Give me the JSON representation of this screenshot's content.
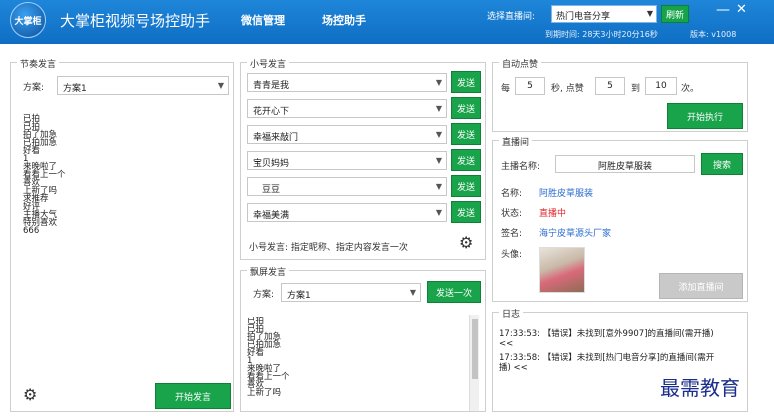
{
  "header": {
    "logo_text": "大掌柜",
    "app_title": "大掌柜视频号场控助手",
    "nav": [
      "微信管理",
      "场控助手"
    ],
    "live_label": "选择直播间:",
    "live_selected": "热门电音分享",
    "refresh_label": "刷新",
    "minimize": "—",
    "close": "✕",
    "expire_text": "到期时间: 28天3小时20分16秒",
    "version_text": "版本: v1008"
  },
  "rhythm": {
    "title": "节奏发言",
    "scheme_label": "方案:",
    "scheme_value": "方案1",
    "lines": [
      "已拍",
      "已拍",
      "拍了加急",
      "已拍加急",
      "好看",
      "1",
      "来晚啦了",
      "看看上一个",
      "喜欢",
      "上新了吗",
      "求推荐",
      "好评",
      "主播大气",
      "特别喜欢",
      "666"
    ],
    "start_label": "开始发言"
  },
  "accounts": {
    "title": "小号发言",
    "rows": [
      {
        "name": "青青是我",
        "send": "发送"
      },
      {
        "name": "花开心下",
        "send": "发送"
      },
      {
        "name": "幸福来敲门",
        "send": "发送"
      },
      {
        "name": "宝贝妈妈",
        "send": "发送"
      },
      {
        "name": "豆豆",
        "send": "发送"
      },
      {
        "name": "幸福美满",
        "send": "发送"
      }
    ],
    "hint": "小号发言: 指定昵称、指定内容发言一次"
  },
  "danmaku": {
    "title": "飘屏发言",
    "scheme_label": "方案:",
    "scheme_value": "方案1",
    "send_once": "发送一次",
    "lines": [
      "已拍",
      "已拍",
      "拍了加急",
      "已拍加急",
      "好看",
      "1",
      "来晚啦了",
      "看看上一个",
      "喜欢",
      "上新了吗"
    ]
  },
  "auto_like": {
    "title": "自动点赞",
    "every": "每",
    "seconds_value": "5",
    "seconds_label": "秒, 点赞",
    "min_value": "5",
    "to": "到",
    "max_value": "10",
    "times": "次。",
    "execute": "开始执行"
  },
  "live_room": {
    "title": "直播间",
    "anchor_label": "主播名称:",
    "anchor_value": "阿胜皮草服装",
    "search": "搜索",
    "name_label": "名称:",
    "name_value": "阿胜皮草服装",
    "status_label": "状态:",
    "status_value": "直播中",
    "sign_label": "签名:",
    "sign_value": "海宁皮草源头厂家",
    "avatar_label": "头像:",
    "add_button": "添加直播间"
  },
  "log": {
    "title": "日志",
    "entries": [
      "17:33:53: 【错误】未找到[意外9907]的直播间(需开播) <<",
      "17:33:58: 【错误】未找到[热门电音分享]的直播间(需开播) <<"
    ]
  },
  "watermark": "最需教育"
}
